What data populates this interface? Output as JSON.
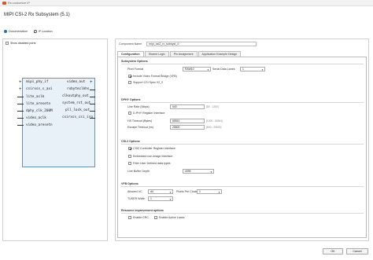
{
  "window": {
    "title": "Re-customize IP"
  },
  "header": {
    "title": "MIPI CSI-2 Rx Subsystem (5.1)",
    "doc_link": "Documentation",
    "loc_link": "IP Location"
  },
  "left": {
    "show_disabled_label": "Show disabled ports",
    "block": {
      "left_ports": [
        "mipi_phy_if",
        "csirxss_s_axi",
        "lite_aclk",
        "lite_aresetn",
        "dphy_clk_200M",
        "video_aclk",
        "video_aresetn"
      ],
      "right_ports": [
        "video_out",
        "rxbyteclkhs",
        "clkoutphy_out",
        "system_rst_out",
        "pll_lock_out",
        "csirxss_csi_irq"
      ]
    }
  },
  "right": {
    "component_name_label": "Component Name",
    "component_name_value": "mipi_csi2_rx_subsyst_0",
    "tabs": [
      "Configuration",
      "Shared Logic",
      "Pin Assignment",
      "Application Example Design"
    ],
    "subsystem": {
      "title": "Subsystem Options",
      "pixel_format_label": "Pixel Format",
      "pixel_format_value": "RAW10",
      "lanes_label": "Serial Data Lanes",
      "lanes_value": "1",
      "vfb_label": "Include Video Format Bridge (VFB)",
      "vc_label": "Support CSI Spec V2_0"
    },
    "dphy": {
      "title": "DPHY Options",
      "line_rate_label": "Line Rate (Mbps)",
      "line_rate_value": "640",
      "line_rate_range": "[80 - 1250]",
      "reg_if_label": "D-PHY Register Interface",
      "hs_timeout_label": "HS Timeout (Bytes)",
      "hs_timeout_value": "65541",
      "hs_timeout_range": "[1000 - 65541]",
      "esc_timeout_label": "Escape Timeout (ns)",
      "esc_timeout_value": "25600",
      "esc_timeout_range": "[800 - 25600]"
    },
    "csi2": {
      "title": "CSI-2 Options",
      "ctrl_reg_label": "CSI2 Controller Register Interface",
      "embedded_label": "Embedded non-image Interface",
      "filter_label": "Filter User Defined data types",
      "buffer_label": "Line Buffer Depth",
      "buffer_value": "4096"
    },
    "vfb": {
      "title": "VFB Options",
      "allowed_vc_label": "Allowed VC",
      "allowed_vc_value": "All",
      "ppc_label": "Pixels Per Clock",
      "ppc_value": "1",
      "tuser_label": "TUSER Width",
      "tuser_value": "1"
    },
    "resource": {
      "title": "Resource Improvement options",
      "crc_label": "Enable CRC",
      "active_lanes_label": "Enable Active Lanes"
    }
  },
  "buttons": {
    "ok": "OK",
    "cancel": "Cancel"
  }
}
